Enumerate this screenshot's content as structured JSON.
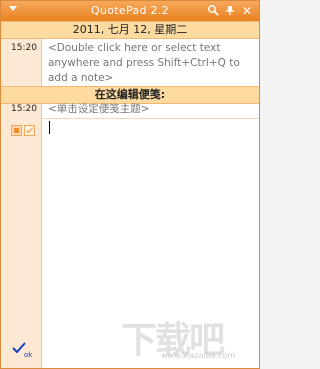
{
  "window": {
    "title": "QuotePad 2.2"
  },
  "date_header": "2011, 七月 12, 星期二",
  "notes": [
    {
      "time": "15:20",
      "text": "<Double click here or select text anywhere and press Shift+Ctrl+Q to add a note>"
    }
  ],
  "edit_header": "在这编辑便笺:",
  "edit_note": {
    "time": "15:20",
    "placeholder": "<单击设定便笺主题>"
  },
  "footer": {
    "ok_label": "ok"
  },
  "watermark": {
    "text": "下载吧",
    "url": "www.xiazaiba.com"
  },
  "colors": {
    "titlebar": "#e8821f",
    "sidebar": "#fde9d3",
    "header_band": "#fcdaa0",
    "ok_blue": "#1a3fc4"
  },
  "icons": [
    "menu-arrow-icon",
    "search-icon",
    "pin-icon",
    "close-icon",
    "note-color-icon",
    "check-icon",
    "ok-check-icon"
  ]
}
